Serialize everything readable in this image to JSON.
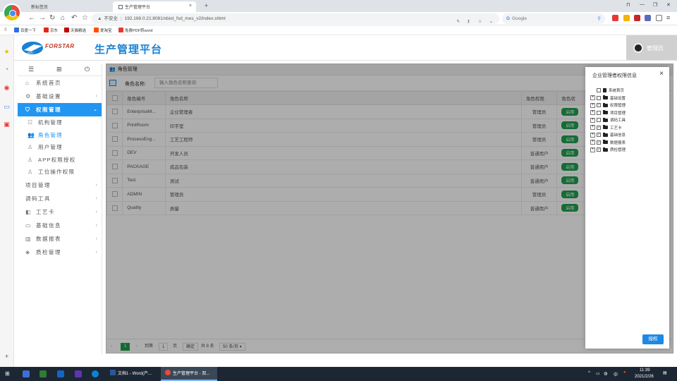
{
  "browser": {
    "tabs": [
      {
        "label": "新标签页"
      },
      {
        "label": "生产管理平台"
      }
    ],
    "url_warning": "不安全",
    "url": "192.168.0.21:8081/xbiot_fsd_mes_v2/index.shtml",
    "search_placeholder": "Google",
    "bookmarks": [
      "百度一下",
      "京东",
      "天猫精选",
      "爱淘宝",
      "免费PDF转word"
    ]
  },
  "app": {
    "brand": "FORSTAR",
    "title": "生产管理平台",
    "user": "管理员"
  },
  "sidebar": {
    "items": [
      {
        "label": "系统首页",
        "icon": "home-icon",
        "arrow": ""
      },
      {
        "label": "基础设置",
        "icon": "gear-icon",
        "arrow": "‹"
      },
      {
        "label": "权限管理",
        "icon": "shield-icon",
        "arrow": "⌄"
      }
    ],
    "sub": [
      {
        "label": "机构管理",
        "icon": "org-icon"
      },
      {
        "label": "角色管理",
        "icon": "group-icon"
      },
      {
        "label": "用户管理",
        "icon": "user-icon"
      },
      {
        "label": "APP权限授权",
        "icon": "user-icon"
      },
      {
        "label": "工位操作权限",
        "icon": "user-icon"
      }
    ],
    "more": [
      {
        "label": "项目管理",
        "icon": "",
        "arrow": "‹"
      },
      {
        "label": "调码工具",
        "icon": "",
        "arrow": "‹"
      },
      {
        "label": "工艺卡",
        "icon": "card-icon",
        "arrow": "‹"
      },
      {
        "label": "基础信息",
        "icon": "monitor-icon",
        "arrow": "‹"
      },
      {
        "label": "数据报表",
        "icon": "table-icon",
        "arrow": "‹"
      },
      {
        "label": "质检管理",
        "icon": "layers-icon",
        "arrow": "‹"
      }
    ]
  },
  "main": {
    "panel_title": "角色管理",
    "search_label": "角色名称:",
    "search_placeholder": "输入角色名称查询",
    "columns": [
      "角色编号",
      "角色名称",
      "角色权限",
      "角色状"
    ],
    "rows": [
      {
        "code": "EnterpriseM...",
        "name": "企业管理者",
        "perm": "管理员",
        "status": "启用"
      },
      {
        "code": "PrintRoom",
        "name": "印字室",
        "perm": "管理员",
        "status": "启用"
      },
      {
        "code": "ProcessEng...",
        "name": "工艺工程师",
        "perm": "管理员",
        "status": "启用"
      },
      {
        "code": "DEV",
        "name": "开发人员",
        "perm": "普通用户",
        "status": "启用"
      },
      {
        "code": "PACKAGE",
        "name": "成品包装",
        "perm": "普通用户",
        "status": "启用"
      },
      {
        "code": "Test",
        "name": "测试",
        "perm": "普通用户",
        "status": "启用"
      },
      {
        "code": "ADMIN",
        "name": "管理员",
        "perm": "管理员",
        "status": "启用"
      },
      {
        "code": "Quality",
        "name": "质量",
        "perm": "普通用户",
        "status": "启用"
      }
    ],
    "pager": {
      "current": "1",
      "goto_label": "到第",
      "page_input": "1",
      "page_unit": "页",
      "confirm": "确定",
      "total": "共 8 条",
      "per_page": "50 条/页"
    }
  },
  "dialog": {
    "title": "企业管理者权限信息",
    "tree": [
      {
        "label": "系统首页",
        "expandable": false,
        "checked": false,
        "type": "doc"
      },
      {
        "label": "基础设置",
        "expandable": true,
        "checked": false,
        "type": "folder"
      },
      {
        "label": "权限管理",
        "expandable": true,
        "checked": true,
        "type": "folder"
      },
      {
        "label": "项目管理",
        "expandable": true,
        "checked": false,
        "type": "folder"
      },
      {
        "label": "调码工具",
        "expandable": true,
        "checked": false,
        "type": "folder"
      },
      {
        "label": "工艺卡",
        "expandable": true,
        "checked": true,
        "type": "folder"
      },
      {
        "label": "基础信息",
        "expandable": true,
        "checked": true,
        "type": "folder"
      },
      {
        "label": "数据报表",
        "expandable": true,
        "checked": true,
        "type": "folder"
      },
      {
        "label": "质检管理",
        "expandable": true,
        "checked": true,
        "type": "folder"
      }
    ],
    "authorize": "授权"
  },
  "taskbar": {
    "items": [
      "文档1 - Word(产...",
      "生产管理平台 - 双..."
    ],
    "ime": "中",
    "time": "11:39",
    "date": "2021/2/26"
  },
  "colors": {
    "accent": "#2196f3",
    "enable": "#20a050",
    "brand_red": "#c0392b"
  }
}
